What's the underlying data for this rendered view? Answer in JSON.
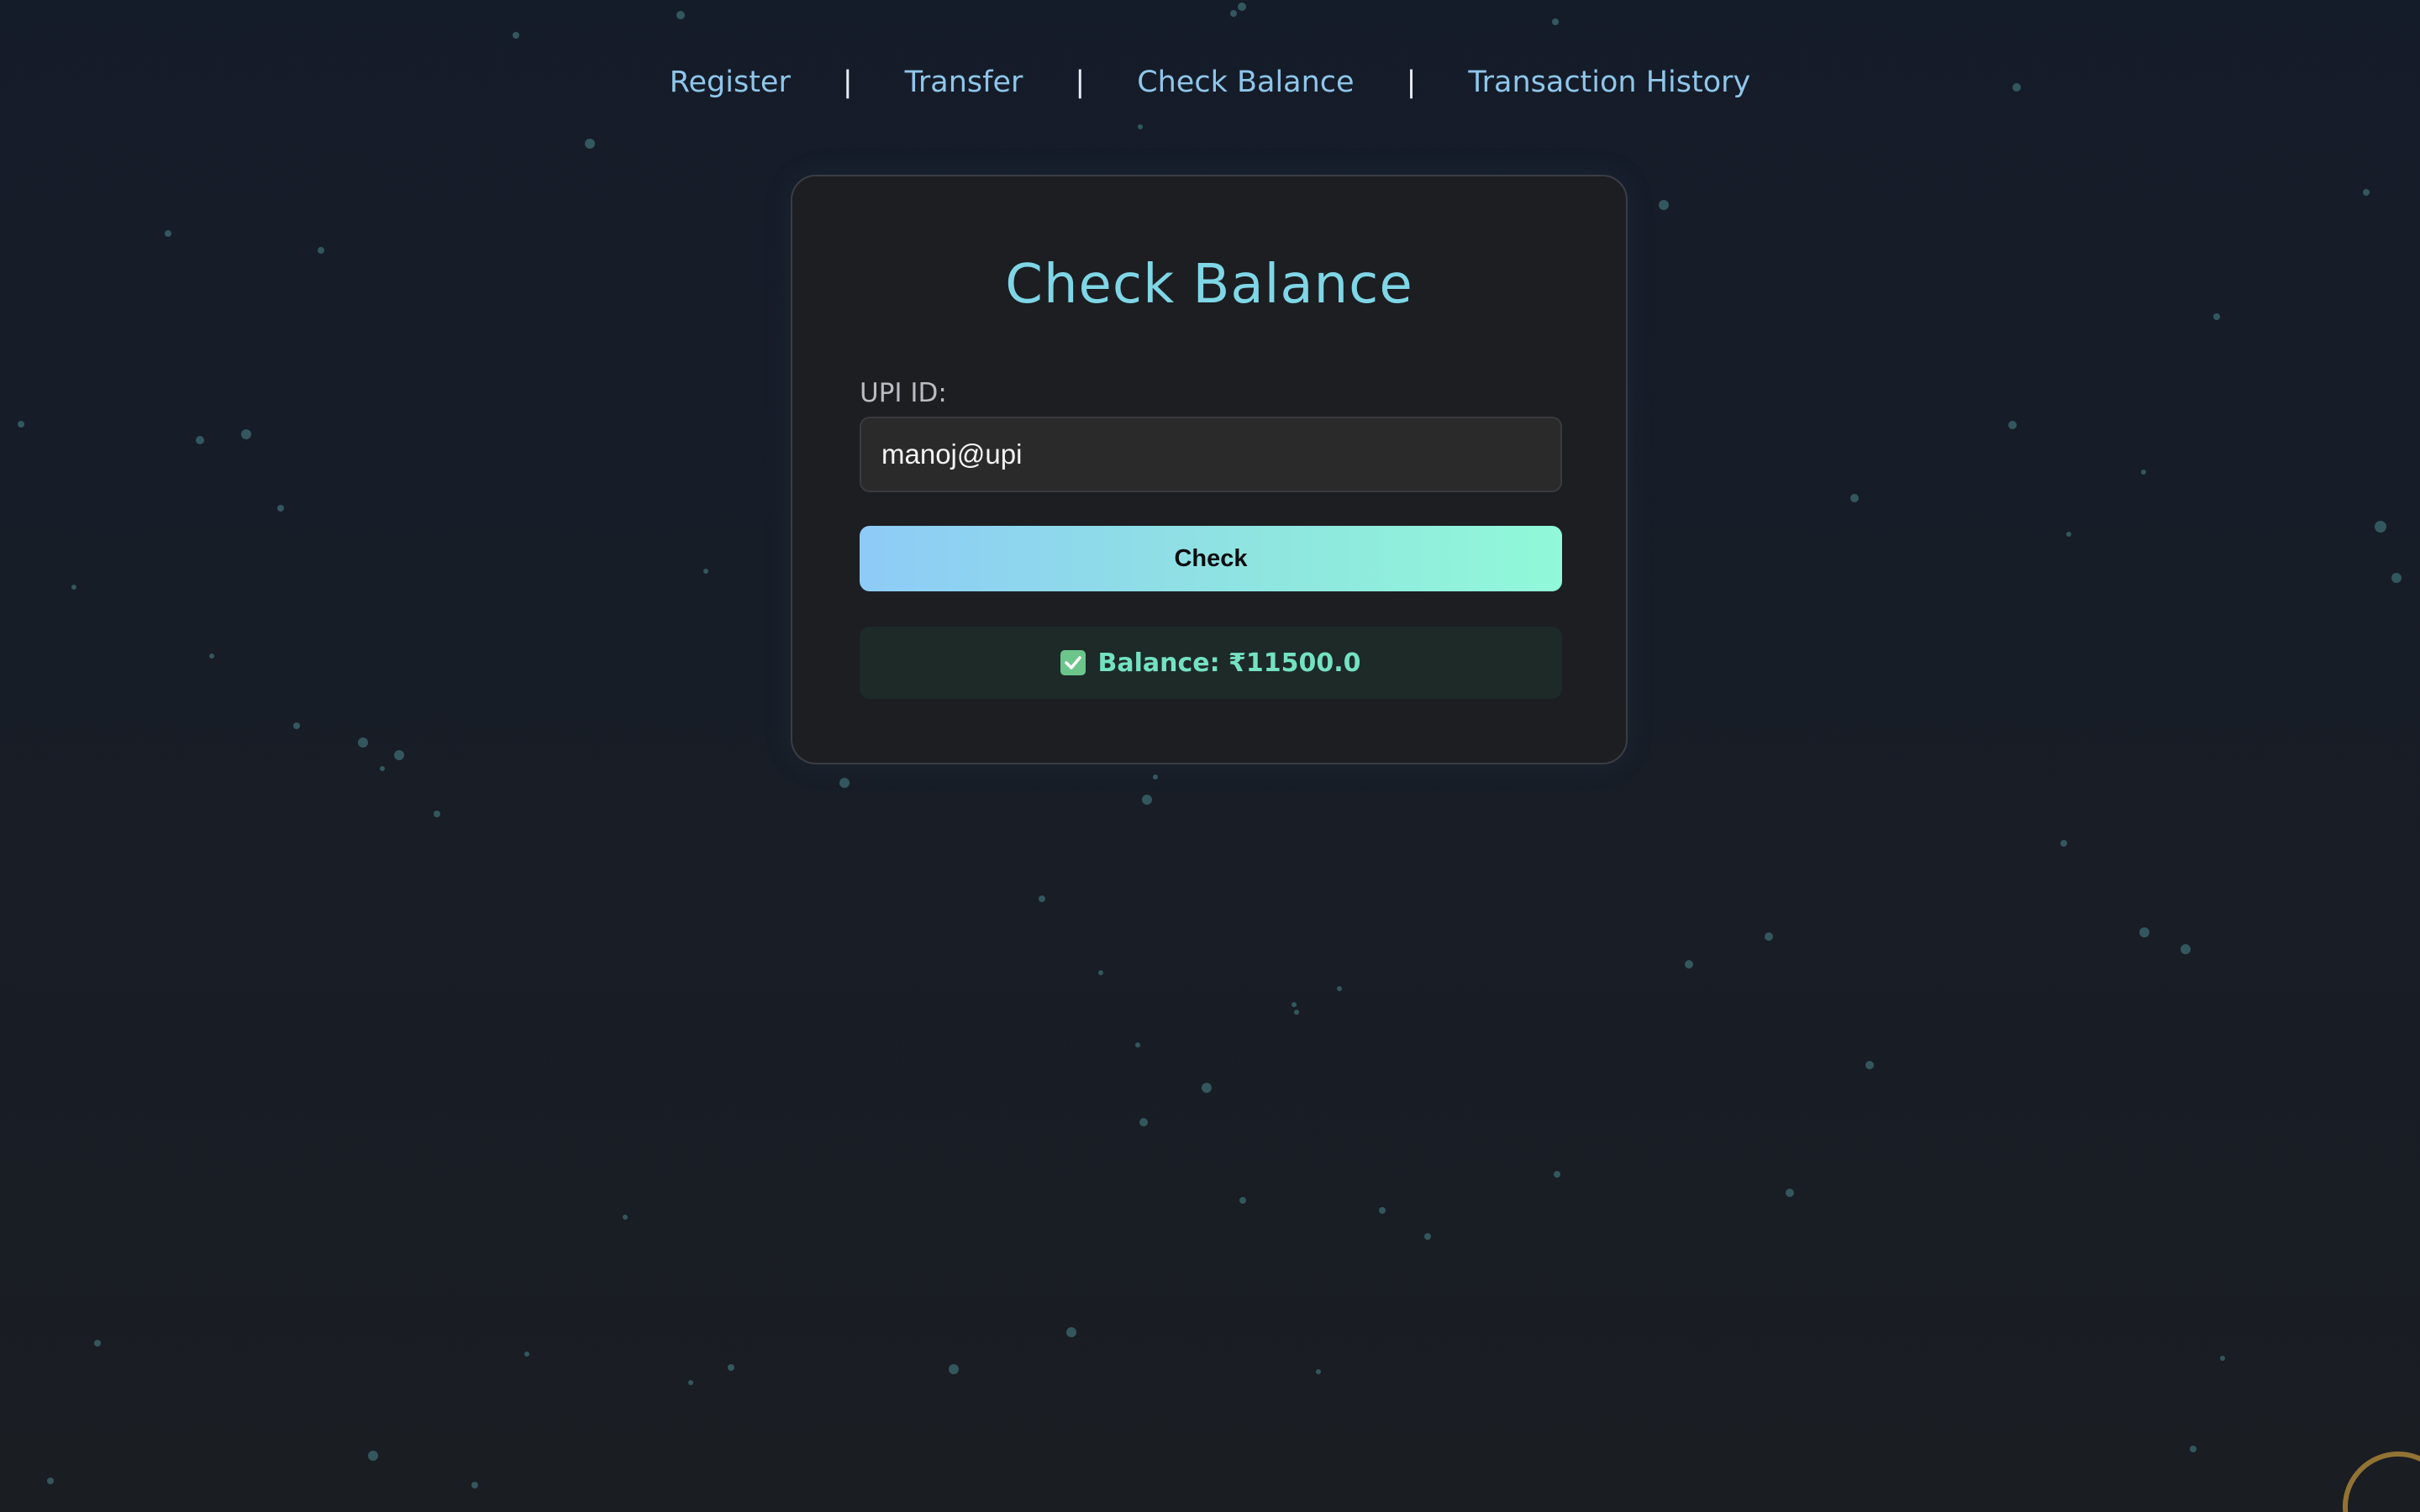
{
  "nav": {
    "items": [
      {
        "label": "Register"
      },
      {
        "label": "Transfer"
      },
      {
        "label": "Check Balance"
      },
      {
        "label": "Transaction History"
      }
    ],
    "separator": "|"
  },
  "card": {
    "title": "Check Balance",
    "upi_label": "UPI ID:",
    "upi_value": "manoj@upi",
    "check_button": "Check",
    "result_text": "Balance: ₹11500.0",
    "result_icon": "check-box-icon"
  },
  "colors": {
    "accent_title": "#7fd6e6",
    "nav_link": "#8fc6ea",
    "result_text": "#74e2c0",
    "button_gradient_start": "#8ecbf7",
    "button_gradient_end": "#90f9d8"
  }
}
